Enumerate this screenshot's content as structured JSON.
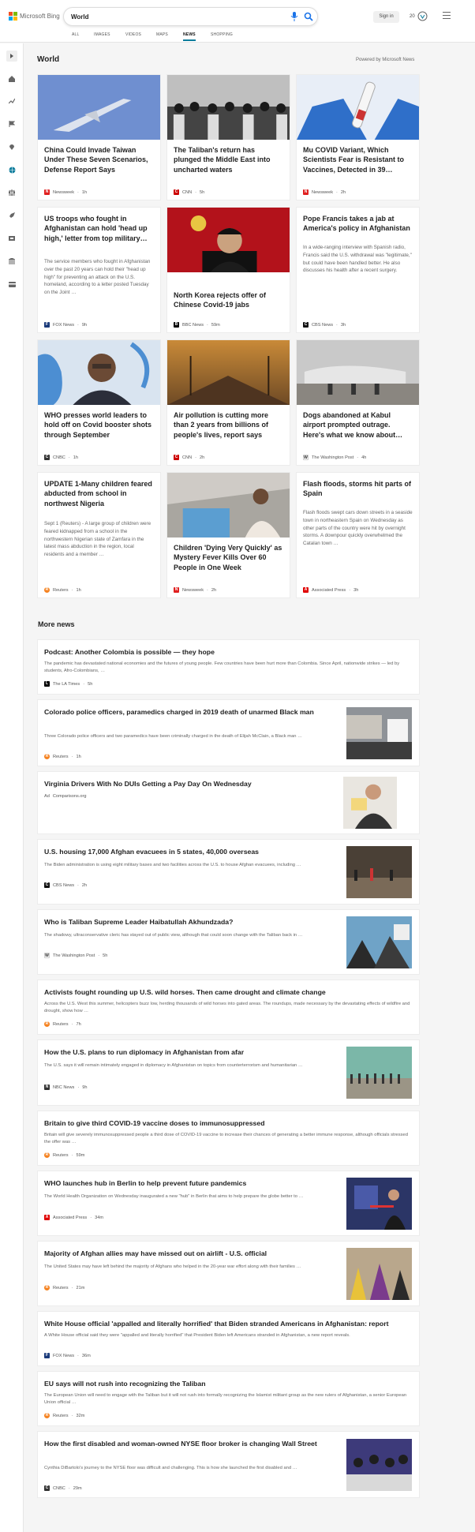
{
  "header": {
    "brand": "Microsoft Bing",
    "query": "World",
    "signin": "Sign in",
    "rewards_count": "20"
  },
  "tabs": [
    {
      "label": "ALL"
    },
    {
      "label": "IMAGES"
    },
    {
      "label": "VIDEOS"
    },
    {
      "label": "MAPS"
    },
    {
      "label": "NEWS"
    },
    {
      "label": "SHOPPING"
    }
  ],
  "sidebar": [
    "chevron-right-icon",
    "home-icon",
    "trending-icon",
    "flag-icon",
    "location-icon",
    "globe-icon",
    "scale-icon",
    "rocket-icon",
    "film-icon",
    "bank-icon",
    "credit-card-icon"
  ],
  "world": {
    "title": "World",
    "powered": "Powered by Microsoft News"
  },
  "cards": [
    {
      "title": "China Could Invade Taiwan Under These Seven Scenarios, Defense Report Says",
      "source": "Newsweek",
      "time": "1h",
      "desc": ""
    },
    {
      "title": "The Taliban's return has plunged the Middle East into uncharted waters",
      "source": "CNN",
      "time": "5h",
      "desc": ""
    },
    {
      "title": "Mu COVID Variant, Which Scientists Fear is Resistant to Vaccines, Detected in 39…",
      "source": "Newsweek",
      "time": "2h",
      "desc": ""
    },
    {
      "title": "US troops who fought in Afghanistan can hold 'head up high,' letter from top military…",
      "source": "FOX News",
      "time": "9h",
      "desc": "The service members who fought in Afghanistan over the past 20 years can hold their \"head up high\" for preventing an attack on the U.S. homeland, according to a letter posted Tuesday on the Joint …"
    },
    {
      "title": "North Korea rejects offer of Chinese Covid-19 jabs",
      "source": "BBC News",
      "time": "59m",
      "desc": ""
    },
    {
      "title": "Pope Francis takes a jab at America's policy in Afghanistan",
      "source": "CBS News",
      "time": "3h",
      "desc": "In a wide-ranging interview with Spanish radio, Francis said the U.S. withdrawal was \"legitimate,\" but could have been handled better. He also discusses his health after a recent surgery."
    },
    {
      "title": "WHO presses world leaders to hold off on Covid booster shots through September",
      "source": "CNBC",
      "time": "1h",
      "desc": ""
    },
    {
      "title": "Air pollution is cutting more than 2 years from billions of people's lives, report says",
      "source": "CNN",
      "time": "2h",
      "desc": ""
    },
    {
      "title": "Dogs abandoned at Kabul airport prompted outrage. Here's what we know about…",
      "source": "The Washington Post",
      "time": "4h",
      "desc": ""
    },
    {
      "title": "UPDATE 1-Many children feared abducted from school in northwest Nigeria",
      "source": "Reuters",
      "time": "1h",
      "desc": "Sept 1 (Reuters) - A large group of children were feared kidnapped from a school in the northwestern Nigerian state of Zamfara in the latest mass abduction in the region, local residents and a member …"
    },
    {
      "title": "Children 'Dying Very Quickly' as Mystery Fever Kills Over 60 People in One Week",
      "source": "Newsweek",
      "time": "2h",
      "desc": ""
    },
    {
      "title": "Flash floods, storms hit parts of Spain",
      "source": "Associated Press",
      "time": "3h",
      "desc": "Flash floods swept cars down streets in a seaside town in northeastern Spain on Wednesday as other parts of the country were hit by overnight storms. A downpour quickly overwhelmed the Catalan town …"
    }
  ],
  "more": {
    "title": "More news",
    "items": [
      {
        "title": "Podcast: Another Colombia is possible — they hope",
        "desc": "The pandemic has devastated national economies and the futures of young people. Few countries have been hurt more than Colombia. Since April, nationwide strikes — led by students, Afro-Colombians, …",
        "source": "The LA Times",
        "time": "5h"
      },
      {
        "title": "Colorado police officers, paramedics charged in 2019 death of unarmed Black man",
        "desc": "Three Colorado police officers and two paramedics have been criminally charged in the death of Elijah McClain, a Black man …",
        "source": "Reuters",
        "time": "1h"
      },
      {
        "title": "Virginia Drivers With No DUIs Getting a Pay Day On Wednesday",
        "desc": "",
        "ad": "Ad",
        "source": "Comparisons.org",
        "time": ""
      },
      {
        "title": "U.S. housing 17,000 Afghan evacuees in 5 states, 40,000 overseas",
        "desc": "The Biden administration is using eight military bases and two facilities across the U.S. to house Afghan evacuees, including …",
        "source": "CBS News",
        "time": "2h"
      },
      {
        "title": "Who is Taliban Supreme Leader Haibatullah Akhundzada?",
        "desc": "The shadowy, ultraconservative cleric has stayed out of public view, although that could soon change with the Taliban back in …",
        "source": "The Washington Post",
        "time": "5h"
      },
      {
        "title": "Activists fought rounding up U.S. wild horses. Then came drought and climate change",
        "desc": "Across the U.S. West this summer, helicopters buzz low, herding thousands of wild horses into gated areas. The roundups, made necessary by the devastating effects of wildfire and drought, show how …",
        "source": "Reuters",
        "time": "7h"
      },
      {
        "title": "How the U.S. plans to run diplomacy in Afghanistan from afar",
        "desc": "The U.S. says it will remain intimately engaged in diplomacy in Afghanistan on topics from counterterrorism and humanitarian …",
        "source": "NBC News",
        "time": "9h"
      },
      {
        "title": "Britain to give third COVID-19 vaccine doses to immunosuppressed",
        "desc": "Britain will give severely immunosuppressed people a third dose of COVID-19 vaccine to increase their chances of generating a better immune response, although officials stressed the offer was …",
        "source": "Reuters",
        "time": "59m"
      },
      {
        "title": "WHO launches hub in Berlin to help prevent future pandemics",
        "desc": "The World Health Organization on Wednesday inaugurated a new \"hub\" in Berlin that aims to help prepare the globe better to …",
        "source": "Associated Press",
        "time": "34m"
      },
      {
        "title": "Majority of Afghan allies may have missed out on airlift - U.S. official",
        "desc": "The United States may have left behind the majority of Afghans who helped in the 20-year war effort along with their families …",
        "source": "Reuters",
        "time": "21m"
      },
      {
        "title": "White House official 'appalled and literally horrified' that Biden stranded Americans in Afghanistan: report",
        "desc": "A White House official said they were \"appalled and literally horrified\" that President Biden left Americans stranded in Afghanistan, a new report reveals.",
        "source": "FOX News",
        "time": "36m"
      },
      {
        "title": "EU says will not rush into recognizing the Taliban",
        "desc": "The European Union will need to engage with the Taliban but it will not rush into formally recognizing the Islamist militant group as the new rulers of Afghanistan, a senior European Union official …",
        "source": "Reuters",
        "time": "32m"
      },
      {
        "title": "How the first disabled and woman-owned NYSE floor broker is changing Wall Street",
        "desc": "Cynthia DiBartolo's journey to the NYSE floor was difficult and challenging. This is how she launched the first disabled and …",
        "source": "CNBC",
        "time": "29m"
      }
    ]
  },
  "colors": {
    "accent": "#0c7c9c",
    "newsweek": "#e02020",
    "cnn": "#cc0000",
    "fox": "#1a3a7a",
    "bbc": "#000000",
    "cbs": "#111111",
    "reuters": "#f58220",
    "ap": "#e00000",
    "nbc": "#333333",
    "latimes": "#000000"
  }
}
